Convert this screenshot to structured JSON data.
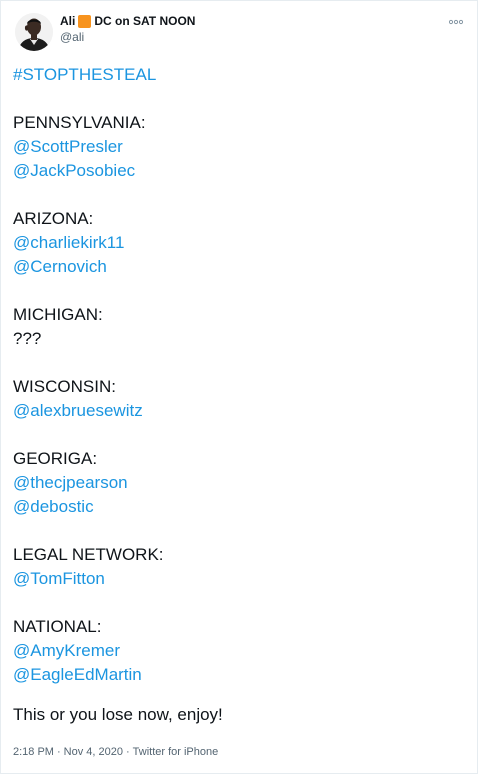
{
  "author": {
    "display_name_prefix": "Ali",
    "display_name_suffix": "DC on SAT NOON",
    "emoji_icon": "orange-square",
    "handle": "@ali"
  },
  "more_icon": "more-dots-icon",
  "tweet": {
    "hashtag": "#STOPTHESTEAL",
    "sections": [
      {
        "state": "PENNSYLVANIA:",
        "mentions": [
          "@ScottPresler",
          "@JackPosobiec"
        ]
      },
      {
        "state": "ARIZONA:",
        "mentions": [
          "@charliekirk11",
          "@Cernovich"
        ]
      },
      {
        "state": "MICHIGAN:",
        "text": "???"
      },
      {
        "state": "WISCONSIN:",
        "mentions": [
          "@alexbruesewitz"
        ]
      },
      {
        "state": "GEORIGA:",
        "mentions": [
          "@thecjpearson",
          "@debostic"
        ]
      },
      {
        "state": "LEGAL NETWORK:",
        "mentions": [
          "@TomFitton"
        ]
      },
      {
        "state": "NATIONAL:",
        "mentions": [
          "@AmyKremer",
          "@EagleEdMartin"
        ]
      }
    ],
    "closing": "This or you lose now, enjoy!"
  },
  "meta": {
    "time": "2:18 PM",
    "separator": "·",
    "date": "Nov 4, 2020",
    "source": "Twitter for iPhone"
  },
  "colors": {
    "link": "#1b95e0",
    "text": "#0f1419",
    "secondary": "#536471",
    "emoji": "#f7931e"
  }
}
